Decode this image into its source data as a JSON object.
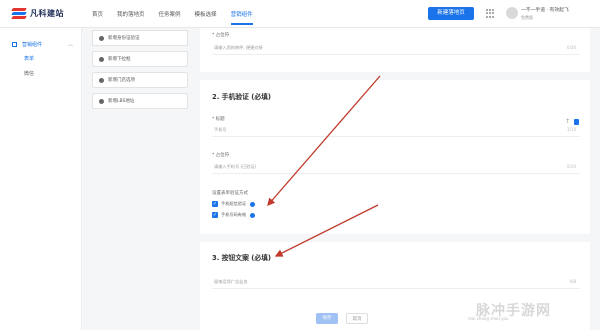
{
  "brand": {
    "name": "凡科建站"
  },
  "nav": {
    "items": [
      "首页",
      "我的落地页",
      "任务案例",
      "模板选择",
      "营销组件"
    ]
  },
  "header": {
    "create_button": "新建落地页",
    "user_name": "一不一手道 · 有效起飞",
    "user_sub": "免费版"
  },
  "sidebar": {
    "group_label": "营销组件",
    "items": [
      "表单",
      "微信"
    ]
  },
  "components": {
    "items": [
      {
        "label": "新增身份证验证",
        "icon": "user-icon"
      },
      {
        "label": "新增下拉框",
        "icon": "dropdown-icon"
      },
      {
        "label": "新增门店选项",
        "icon": "store-icon"
      },
      {
        "label": "新增LBS地址",
        "icon": "location-icon"
      }
    ]
  },
  "form": {
    "top_label": "* 占位符",
    "top_field": {
      "placeholder": "请输入您的称呼, 便捷对接",
      "count": "0/20"
    },
    "section2": {
      "title": "2. 手机验证 (必填)"
    },
    "title_label": "* 标题",
    "title_field": {
      "value": "手机号",
      "count": "3/10"
    },
    "placeholder_label": "* 占位符",
    "placeholder_field": {
      "value": "请输入手机号 (已验证)",
      "count": "0/20"
    },
    "verify_label": "设置表单验证方式",
    "checkboxes": [
      {
        "label": "手机短信验证",
        "checked": true
      },
      {
        "label": "手机号码有效",
        "checked": true
      }
    ],
    "section3": {
      "title": "3. 按钮文案 (必填)"
    },
    "button_field": {
      "value": "留电话领广告业务",
      "count": "0/8"
    }
  },
  "footer": {
    "save_label": "保存",
    "cancel_label": "取消"
  },
  "watermark": {
    "main": "脉冲手游网",
    "sub": "mai chong shou you"
  },
  "colors": {
    "accent": "#1a73e8",
    "annotation": "#c0392b"
  }
}
